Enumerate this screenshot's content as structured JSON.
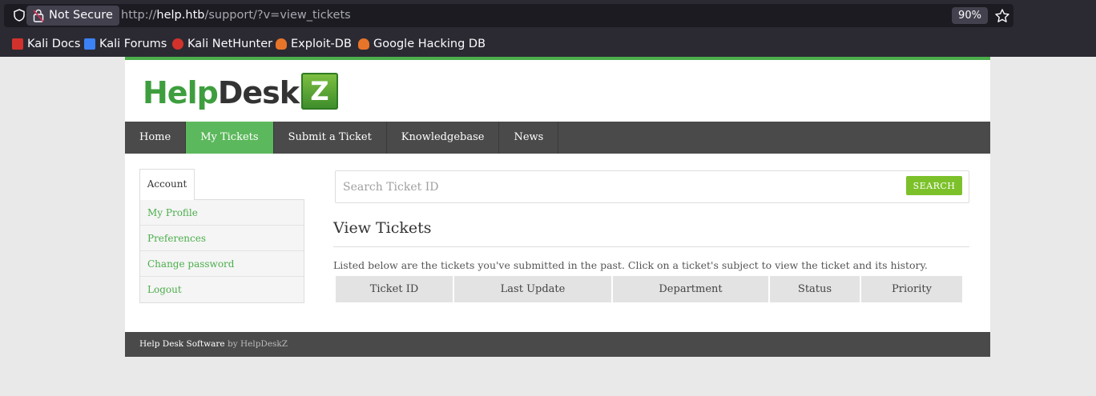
{
  "browser": {
    "security_label": "Not Secure",
    "url_prefix": "http://",
    "url_host": "help.htb",
    "url_path": "/support/?v=view_tickets",
    "zoom": "90%",
    "bookmarks": [
      {
        "label": "Kali Docs",
        "icon": "kali-docs-icon",
        "color": "#d3322c"
      },
      {
        "label": "Kali Forums",
        "icon": "kali-forums-icon",
        "color": "#3b82f6"
      },
      {
        "label": "Kali NetHunter",
        "icon": "kali-nethunter-icon",
        "color": "#d3322c"
      },
      {
        "label": "Exploit-DB",
        "icon": "exploit-db-icon",
        "color": "#e8742a"
      },
      {
        "label": "Google Hacking DB",
        "icon": "ghdb-icon",
        "color": "#e8742a"
      }
    ]
  },
  "logo": {
    "part1": "Help",
    "part2": "Desk",
    "badge": "Z"
  },
  "nav": {
    "items": [
      {
        "label": "Home",
        "active": false
      },
      {
        "label": "My Tickets",
        "active": true
      },
      {
        "label": "Submit a Ticket",
        "active": false
      },
      {
        "label": "Knowledgebase",
        "active": false
      },
      {
        "label": "News",
        "active": false
      }
    ]
  },
  "sidebar": {
    "tab_label": "Account",
    "items": [
      "My Profile",
      "Preferences",
      "Change password",
      "Logout"
    ]
  },
  "search": {
    "placeholder": "Search Ticket ID",
    "button_label": "SEARCH"
  },
  "main": {
    "title": "View Tickets",
    "intro": "Listed below are the tickets you've submitted in the past. Click on a ticket's subject to view the ticket and its history.",
    "columns": [
      "Ticket ID",
      "Last Update",
      "Department",
      "Status",
      "Priority"
    ]
  },
  "footer": {
    "link": "Help Desk Software",
    "by": "by HelpDeskZ"
  },
  "colors": {
    "accent": "#5cb85c",
    "nav_bg": "#4a4a4a",
    "search_btn": "#7cc12a"
  }
}
